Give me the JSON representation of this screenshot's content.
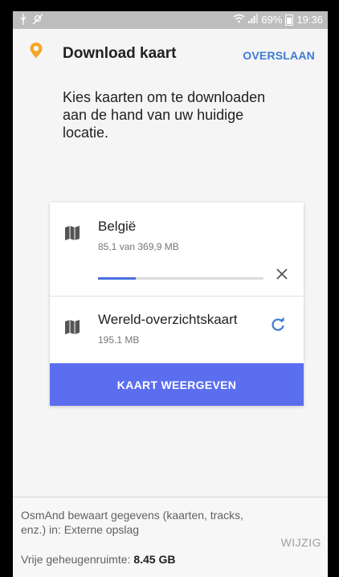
{
  "status_bar": {
    "battery": "69%",
    "time": "19:36",
    "icons": [
      "usb-icon",
      "location-off-icon",
      "wifi-icon",
      "signal-icon",
      "battery-icon"
    ]
  },
  "header": {
    "title": "Download kaart",
    "skip_label": "OVERSLAAN",
    "logo_icon": "osmand-pin-icon"
  },
  "intro_text": "Kies kaarten om te downloaden aan de hand van uw huidige locatie.",
  "maps": [
    {
      "name": "België",
      "size_text": "85,1 van 369,9 MB",
      "progress_fraction": 0.23,
      "icon": "map-icon",
      "action_icon": "close-icon"
    },
    {
      "name": "Wereld-overzichtskaart",
      "size_text": "195.1 MB",
      "icon": "map-icon",
      "action_icon": "refresh-icon"
    }
  ],
  "primary_button": "KAART WEERGEVEN",
  "footer": {
    "storage_text": "OsmAnd bewaart gegevens (kaarten, tracks, enz.) in: Externe opslag",
    "free_label": "Vrije geheugenruimte: ",
    "free_value": "8.45 GB",
    "change_label": "WIJZIG"
  },
  "colors": {
    "accent": "#3b7bd4",
    "button": "#5b6ef0",
    "logo": "#f5a623",
    "progress": "#4b6fde"
  }
}
